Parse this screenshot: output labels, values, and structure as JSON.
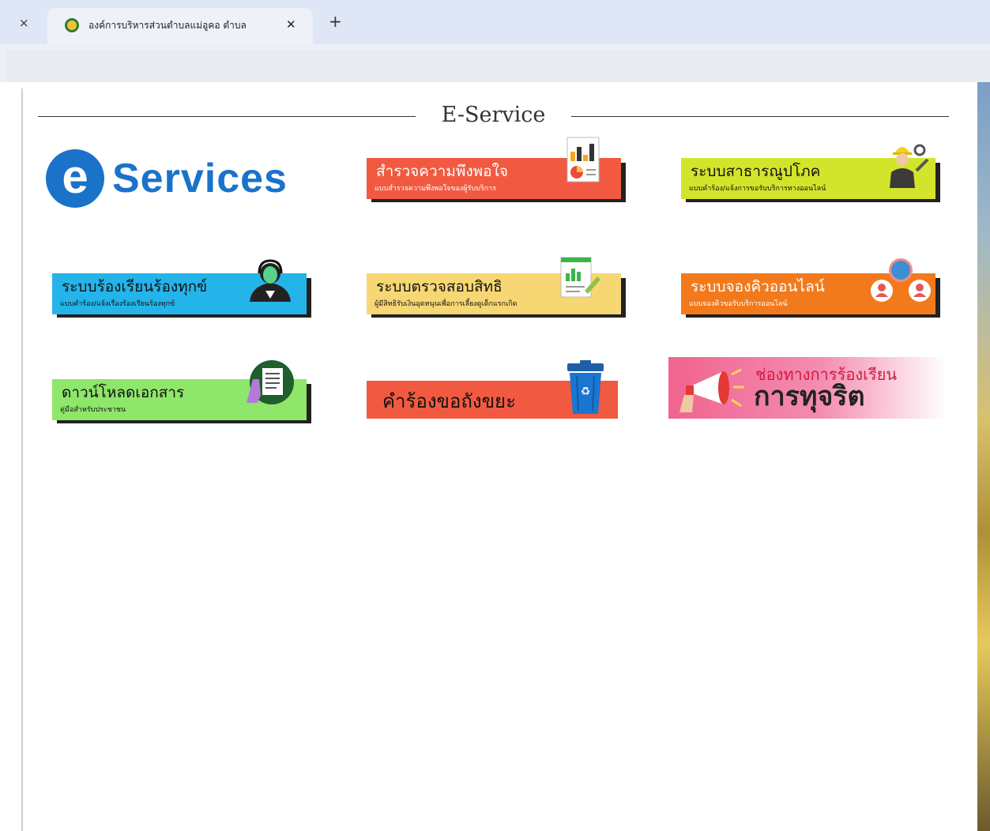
{
  "browser": {
    "tab_title": "องค์การบริหารส่วนตำบลแม่อูคอ ตำบล",
    "window_close_glyph": "×",
    "tab_close_glyph": "✕",
    "new_tab_glyph": "+"
  },
  "page": {
    "section_title": "E-Service",
    "logo": {
      "e": "e",
      "word": "Services"
    }
  },
  "cards": [
    {
      "main": "สำรวจความพึงพอใจ",
      "sub": "แบบสำรวจความพึงพอใจของผู้รับบริการ",
      "color": "#f15a41",
      "icon": "report-chart-icon"
    },
    {
      "main": "ระบบสาธารณูปโภค",
      "sub": "แบบคำร้อง/แจ้งการขอรับบริการทางออนไลน์",
      "color": "#d3e52a",
      "icon": "engineer-icon"
    },
    {
      "main": "ระบบร้องเรียนร้องทุกข์",
      "sub": "แบบคำร้อง/แจ้งเรื่องร้องเรียนร้องทุกข์",
      "color": "#24b4ea",
      "icon": "call-center-agent-icon"
    },
    {
      "main": "ระบบตรวจสอบสิทธิ",
      "sub": "ผู้มีสิทธิรับเงินอุดหนุนเพื่อการเลี้ยงดูเด็กแรกเกิด",
      "color": "#f6d774",
      "icon": "document-chart-icon"
    },
    {
      "main": "ระบบจองคิวออนไลน์",
      "sub": "แบบจองคิวขอรับบริการออนไลน์",
      "color": "#f27a1c",
      "icon": "users-queue-icon"
    },
    {
      "main": "ดาวน์โหลดเอกสาร",
      "sub": "คู่มือสำหรับประชาชน",
      "color": "#8ee66a",
      "icon": "document-download-icon"
    },
    {
      "main": "คำร้องขอถังขยะ",
      "color": "#f15a41",
      "icon": "recycle-bin-icon"
    }
  ],
  "complaint_banner": {
    "line1": "ช่องทางการร้องเรียน",
    "line2": "การทุจริต",
    "icon": "megaphone-icon"
  }
}
